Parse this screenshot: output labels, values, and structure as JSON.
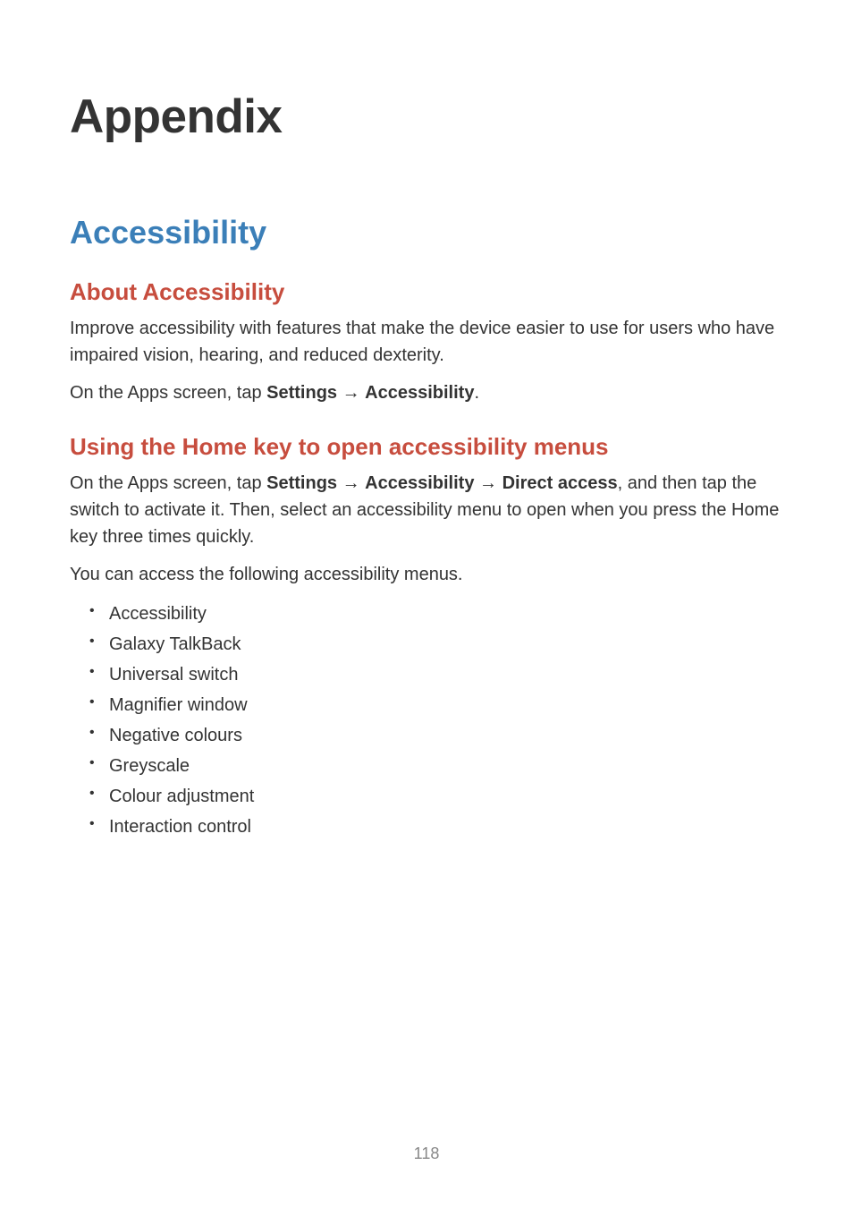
{
  "chapter": {
    "title": "Appendix"
  },
  "section": {
    "title": "Accessibility"
  },
  "subsection1": {
    "title": "About Accessibility",
    "para1": "Improve accessibility with features that make the device easier to use for users who have impaired vision, hearing, and reduced dexterity.",
    "para2_pre": "On the Apps screen, tap ",
    "para2_bold1": "Settings",
    "para2_arrow": " → ",
    "para2_bold2": "Accessibility",
    "para2_post": "."
  },
  "subsection2": {
    "title": "Using the Home key to open accessibility menus",
    "para1_pre": "On the Apps screen, tap ",
    "para1_bold1": "Settings",
    "para1_arrow1": " → ",
    "para1_bold2": "Accessibility",
    "para1_arrow2": " → ",
    "para1_bold3": "Direct access",
    "para1_post": ", and then tap the switch to activate it. Then, select an accessibility menu to open when you press the Home key three times quickly.",
    "para2": "You can access the following accessibility menus.",
    "items": [
      "Accessibility",
      "Galaxy TalkBack",
      "Universal switch",
      "Magnifier window",
      "Negative colours",
      "Greyscale",
      "Colour adjustment",
      "Interaction control"
    ]
  },
  "pageNumber": "118"
}
